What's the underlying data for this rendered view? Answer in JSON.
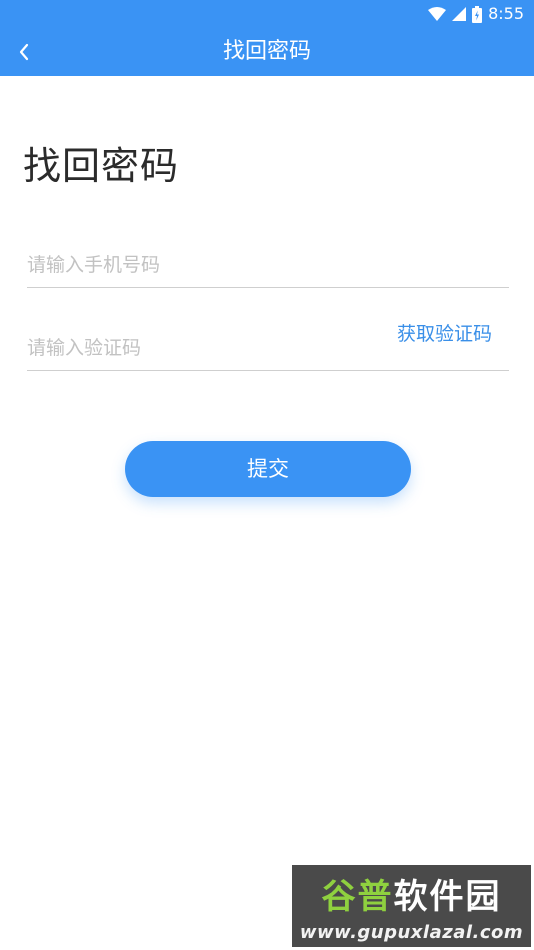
{
  "status_bar": {
    "time": "8:55",
    "icons": [
      "wifi-icon",
      "cellular-signal-icon",
      "battery-icon"
    ]
  },
  "app_bar": {
    "title": "找回密码",
    "back_icon": "chevron-left-icon"
  },
  "page": {
    "heading": "找回密码"
  },
  "form": {
    "phone_placeholder": "请输入手机号码",
    "phone_value": "",
    "code_placeholder": "请输入验证码",
    "code_value": "",
    "get_code_label": "获取验证码",
    "submit_label": "提交"
  },
  "watermark": {
    "brand_part1": "谷普",
    "brand_part2": "软件园",
    "url": "www.gupuxlazal.com"
  },
  "colors": {
    "primary": "#3a93f4",
    "link": "#3a8fe8",
    "heading": "#2b2b2b",
    "placeholder": "#c2c2c2",
    "divider": "#cfcfcf"
  }
}
